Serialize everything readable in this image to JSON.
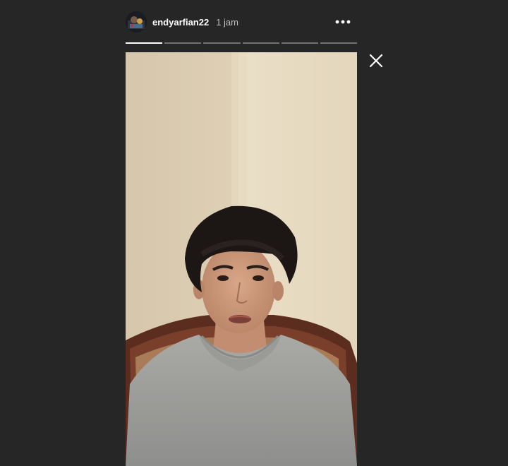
{
  "story": {
    "username": "endyarfian22",
    "timestamp": "1 jam",
    "progress": {
      "segment_count": 6,
      "active_index": 0,
      "active_fraction": 1.0
    }
  },
  "icons": {
    "avatar": "profile-avatar",
    "more": "more-options-icon",
    "close": "close-icon"
  },
  "colors": {
    "background": "#262626",
    "text": "#ffffff",
    "timestamp": "#bfbfbf",
    "progress_track": "rgba(255,255,255,0.35)",
    "progress_fill": "#ffffff"
  }
}
